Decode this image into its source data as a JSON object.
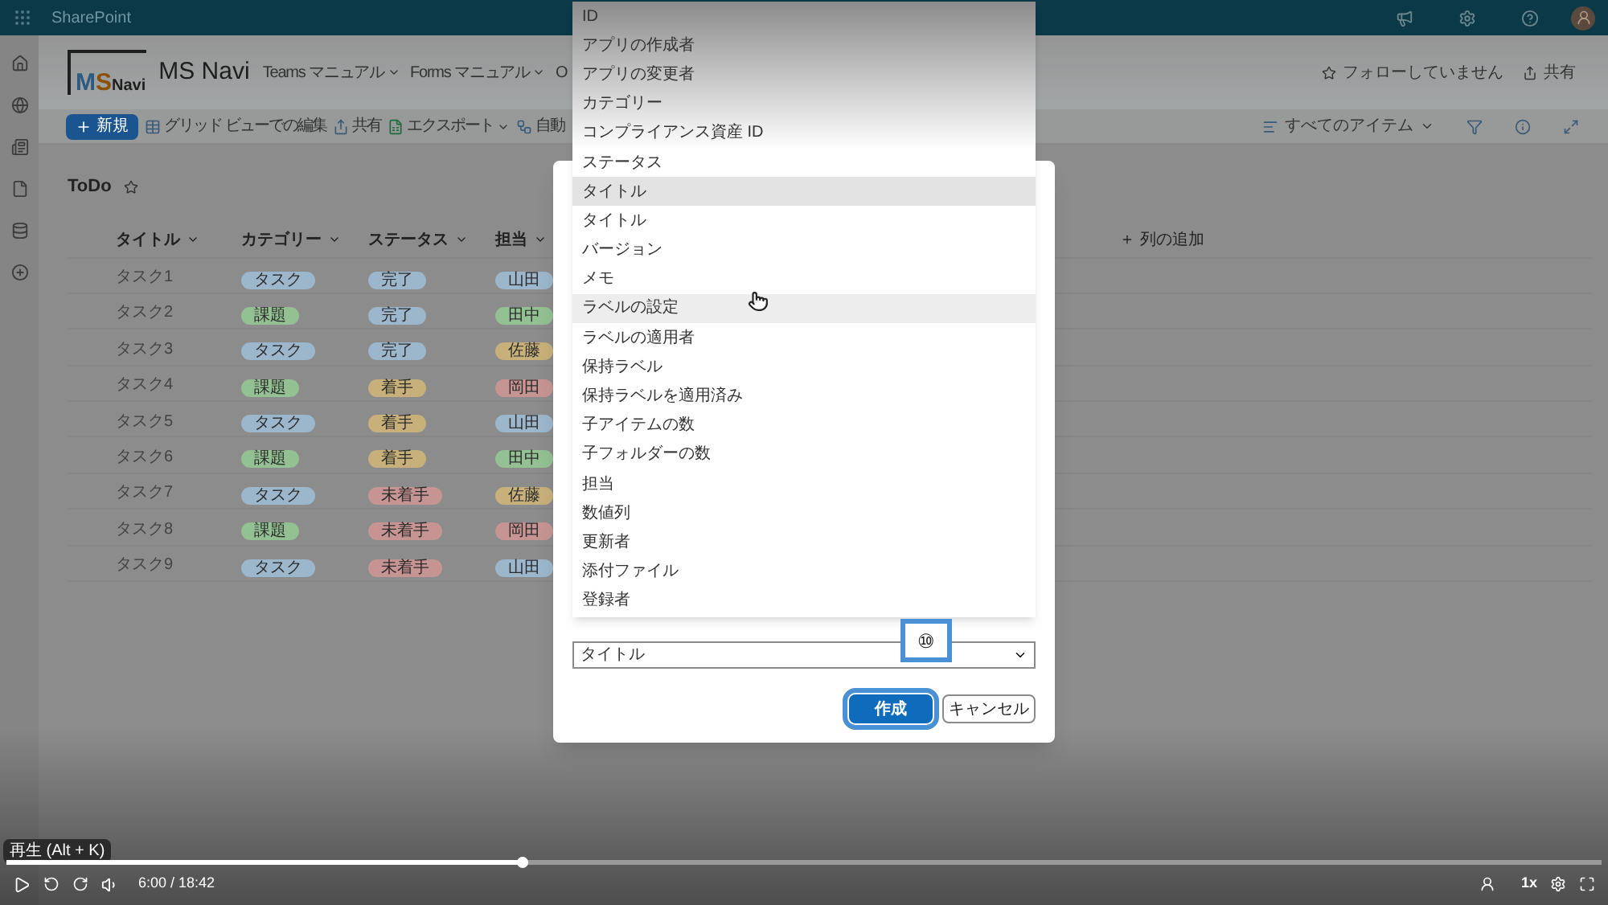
{
  "top_bar": {
    "app_name": "SharePoint"
  },
  "site": {
    "logo_parts": [
      {
        "text": "M",
        "color": "#2d5a80"
      },
      {
        "text": "S",
        "color": "#8a5208"
      },
      {
        "text": "Navi",
        "color": "#1e1e1e"
      }
    ],
    "name": "MS Navi",
    "nav": [
      "Teams マニュアル",
      "Forms マニュアル",
      "O"
    ],
    "actions": [
      "フォローしていません",
      "共有"
    ]
  },
  "command_bar": {
    "new_button": "新規",
    "items": [
      "グリッド ビューでの編集",
      "共有",
      "エクスポート",
      "自動"
    ],
    "view": "すべてのアイテム"
  },
  "list": {
    "title": "ToDo",
    "columns": [
      "タイトル",
      "カテゴリー",
      "ステータス",
      "担当"
    ],
    "add_column": "列の追加",
    "rows": [
      {
        "title": "タスク1",
        "category": {
          "text": "タスク",
          "color": "#9cb6cc"
        },
        "status": {
          "text": "完了",
          "color": "#9cb6cc"
        },
        "assignee": {
          "text": "山田",
          "color": "#9cb6cc"
        }
      },
      {
        "title": "タスク2",
        "category": {
          "text": "課題",
          "color": "#93c193"
        },
        "status": {
          "text": "完了",
          "color": "#9cb6cc"
        },
        "assignee": {
          "text": "田中",
          "color": "#93c193"
        }
      },
      {
        "title": "タスク3",
        "category": {
          "text": "タスク",
          "color": "#9cb6cc"
        },
        "status": {
          "text": "完了",
          "color": "#9cb6cc"
        },
        "assignee": {
          "text": "佐藤",
          "color": "#c8b07a"
        }
      },
      {
        "title": "タスク4",
        "category": {
          "text": "課題",
          "color": "#93c193"
        },
        "status": {
          "text": "着手",
          "color": "#c8b07a"
        },
        "assignee": {
          "text": "岡田",
          "color": "#c79494"
        }
      },
      {
        "title": "タスク5",
        "category": {
          "text": "タスク",
          "color": "#9cb6cc"
        },
        "status": {
          "text": "着手",
          "color": "#c8b07a"
        },
        "assignee": {
          "text": "山田",
          "color": "#9cb6cc"
        }
      },
      {
        "title": "タスク6",
        "category": {
          "text": "課題",
          "color": "#93c193"
        },
        "status": {
          "text": "着手",
          "color": "#c8b07a"
        },
        "assignee": {
          "text": "田中",
          "color": "#93c193"
        }
      },
      {
        "title": "タスク7",
        "category": {
          "text": "タスク",
          "color": "#9cb6cc"
        },
        "status": {
          "text": "未着手",
          "color": "#c79494"
        },
        "assignee": {
          "text": "佐藤",
          "color": "#c8b07a"
        }
      },
      {
        "title": "タスク8",
        "category": {
          "text": "課題",
          "color": "#93c193"
        },
        "status": {
          "text": "未着手",
          "color": "#c79494"
        },
        "assignee": {
          "text": "岡田",
          "color": "#c79494"
        }
      },
      {
        "title": "タスク9",
        "category": {
          "text": "タスク",
          "color": "#9cb6cc"
        },
        "status": {
          "text": "未着手",
          "color": "#c79494"
        },
        "assignee": {
          "text": "山田",
          "color": "#9cb6cc"
        }
      }
    ]
  },
  "dialog": {
    "options": [
      {
        "label": "ID",
        "selected": false,
        "hovered": false
      },
      {
        "label": "アプリの作成者",
        "selected": false,
        "hovered": false
      },
      {
        "label": "アプリの変更者",
        "selected": false,
        "hovered": false
      },
      {
        "label": "カテゴリー",
        "selected": false,
        "hovered": false
      },
      {
        "label": "コンプライアンス資産 ID",
        "selected": false,
        "hovered": false
      },
      {
        "label": "ステータス",
        "selected": false,
        "hovered": false
      },
      {
        "label": "タイトル",
        "selected": true,
        "hovered": false
      },
      {
        "label": "タイトル",
        "selected": false,
        "hovered": false
      },
      {
        "label": "バージョン",
        "selected": false,
        "hovered": false
      },
      {
        "label": "メモ",
        "selected": false,
        "hovered": false
      },
      {
        "label": "ラベルの設定",
        "selected": false,
        "hovered": true
      },
      {
        "label": "ラベルの適用者",
        "selected": false,
        "hovered": false
      },
      {
        "label": "保持ラベル",
        "selected": false,
        "hovered": false
      },
      {
        "label": "保持ラベルを適用済み",
        "selected": false,
        "hovered": false
      },
      {
        "label": "子アイテムの数",
        "selected": false,
        "hovered": false
      },
      {
        "label": "子フォルダーの数",
        "selected": false,
        "hovered": false
      },
      {
        "label": "担当",
        "selected": false,
        "hovered": false
      },
      {
        "label": "数値列",
        "selected": false,
        "hovered": false
      },
      {
        "label": "更新者",
        "selected": false,
        "hovered": false
      },
      {
        "label": "添付ファイル",
        "selected": false,
        "hovered": false
      },
      {
        "label": "登録者",
        "selected": false,
        "hovered": false
      }
    ],
    "field_value": "タイトル",
    "primary_button": "作成",
    "cancel_button": "キャンセル",
    "callout": "⑩"
  },
  "player": {
    "tooltip": "再生 (Alt + K)",
    "level": 0.324,
    "time": "6:00 / 18:42",
    "speed": "1x"
  }
}
